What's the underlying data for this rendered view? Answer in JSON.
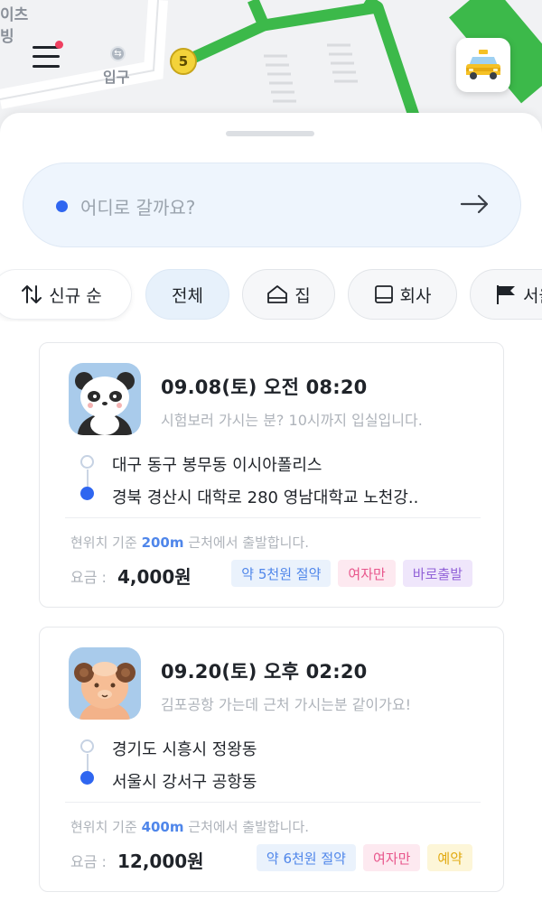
{
  "map": {
    "label_top": "이츠",
    "label_top2": "빙",
    "exit_label": "입구",
    "line_badge": "5"
  },
  "search": {
    "placeholder": "어디로 갈까요?"
  },
  "filters": {
    "sort_label": "신규 순",
    "chips": [
      "전체",
      "집",
      "회사",
      "서울"
    ]
  },
  "trips": [
    {
      "datetime": "09.08(토) 오전 08:20",
      "memo": "시험보러 가시는 분? 10시까지 입실입니다.",
      "from": "대구 동구 봉무동 이시아폴리스",
      "to": "경북 경산시 대학로 280 영남대학교 노천강..",
      "distance_prefix": "현위치 기준",
      "distance_value": "200m",
      "distance_suffix": "근처에서 출발합니다.",
      "fare_label": "요금 :",
      "fare": "4,000원",
      "tags": [
        {
          "text": "약 5천원 절약",
          "style": "blue"
        },
        {
          "text": "여자만",
          "style": "pink"
        },
        {
          "text": "바로출발",
          "style": "purple"
        }
      ],
      "avatar": "panda"
    },
    {
      "datetime": "09.20(토) 오후 02:20",
      "memo": "김포공항 가는데 근처 가시는분 같이가요!",
      "from": "경기도 시흥시 정왕동",
      "to": "서울시 강서구 공항동",
      "distance_prefix": "현위치 기준",
      "distance_value": "400m",
      "distance_suffix": "근처에서 출발합니다.",
      "fare_label": "요금 :",
      "fare": "12,000원",
      "tags": [
        {
          "text": "약 6천원 절약",
          "style": "blue"
        },
        {
          "text": "여자만",
          "style": "pink"
        },
        {
          "text": "예약",
          "style": "yellow"
        }
      ],
      "avatar": "ram"
    }
  ],
  "colors": {
    "accent_blue": "#2f66f0",
    "map_green": "#3cb94a",
    "search_bg": "#eef5fd"
  }
}
